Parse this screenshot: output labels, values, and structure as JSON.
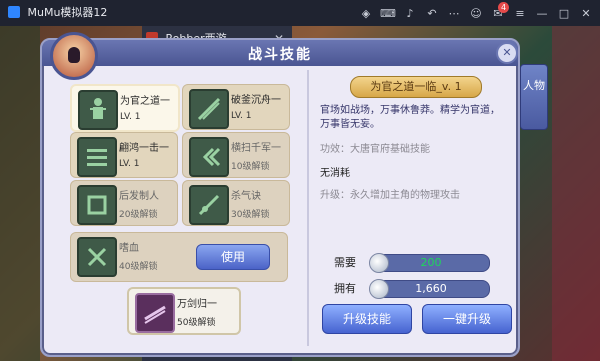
{
  "window": {
    "app_tab": "MuMu模拟器12",
    "game_tab": "Robber西游"
  },
  "colors": {
    "panel_header": "#4a5592",
    "accent_button": "#4b63c7",
    "need_value": "#1fd65c"
  },
  "panel": {
    "title": "战斗技能",
    "side_tab_label": "人物",
    "use_button": "使用",
    "skills": [
      {
        "name": "为官之道一",
        "sub": "LV. 1"
      },
      {
        "name": "破釜沉舟一",
        "sub": "LV. 1"
      },
      {
        "name": "翩鸿一击一",
        "sub": "LV. 1"
      },
      {
        "name": "横扫千军一",
        "sub": "10级解锁"
      },
      {
        "name": "后发制人",
        "sub": "20级解锁"
      },
      {
        "name": "杀气诀",
        "sub": "30级解锁"
      },
      {
        "name": "嗜血",
        "sub": "40级解锁"
      }
    ],
    "special_skill": {
      "name": "万剑归一",
      "sub": "50级解锁"
    },
    "detail": {
      "title": "为官之道一临_v. 1",
      "description": "官场如战场，万事休鲁莽。精学为官道，万事皆无妄。",
      "effect": "功效：大唐官府基础技能",
      "cost": "无消耗",
      "upgrade": "升级：永久增加主角的物理攻击"
    },
    "requirements": {
      "need_label": "需要",
      "need_value": "200",
      "have_label": "拥有",
      "have_value": "1,660"
    },
    "buttons": {
      "upgrade_skill": "升级技能",
      "one_click_upgrade": "一键升级"
    }
  }
}
